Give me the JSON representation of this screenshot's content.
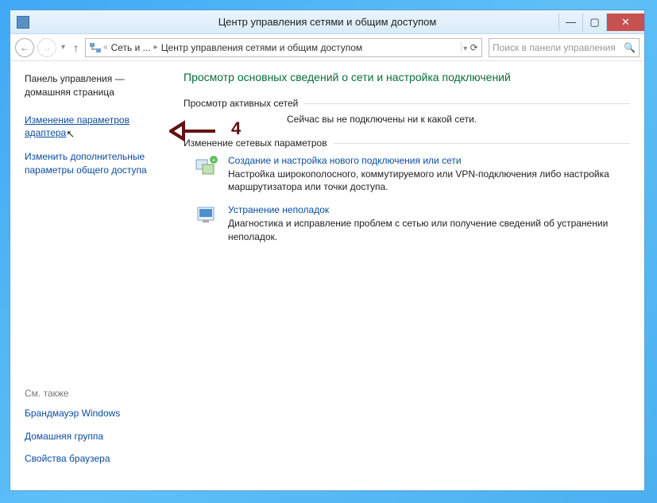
{
  "titlebar": {
    "title": "Центр управления сетями и общим доступом"
  },
  "navbar": {
    "addr1": "Сеть и ...",
    "addr2": "Центр управления сетями и общим доступом",
    "search_placeholder": "Поиск в панели управления"
  },
  "sidebar": {
    "home": "Панель управления — домашняя страница",
    "link_adapter": "Изменение параметров адаптера",
    "link_sharing": "Изменить дополнительные параметры общего доступа",
    "see_also_label": "См. также",
    "see_also": [
      "Брандмауэр Windows",
      "Домашняя группа",
      "Свойства браузера"
    ]
  },
  "main": {
    "heading": "Просмотр основных сведений о сети и настройка подключений",
    "active_label": "Просмотр активных сетей",
    "active_status": "Сейчас вы не подключены ни к какой сети.",
    "change_label": "Изменение сетевых параметров",
    "opt1_title": "Создание и настройка нового подключения или сети",
    "opt1_desc": "Настройка широкополосного, коммутируемого или VPN-подключения либо настройка маршрутизатора или точки доступа.",
    "opt2_title": "Устранение неполадок",
    "opt2_desc": "Диагностика и исправление проблем с сетью или получение сведений об устранении неполадок."
  },
  "annotation": {
    "label": "4"
  }
}
